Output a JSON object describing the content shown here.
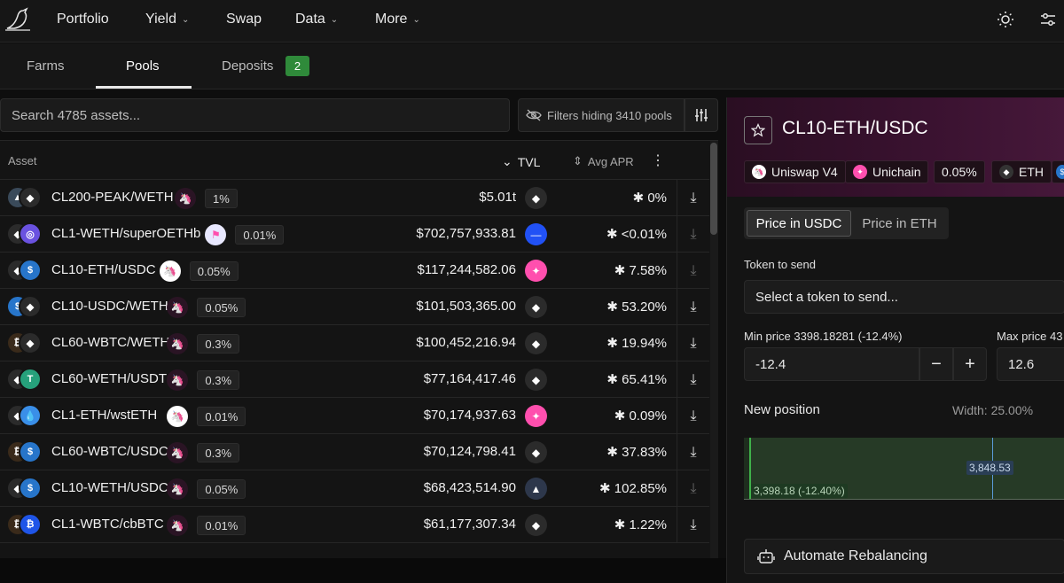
{
  "nav": {
    "items": [
      {
        "label": "Portfolio",
        "has_dropdown": false
      },
      {
        "label": "Yield",
        "has_dropdown": true
      },
      {
        "label": "Swap",
        "has_dropdown": false
      },
      {
        "label": "Data",
        "has_dropdown": true
      },
      {
        "label": "More",
        "has_dropdown": true
      }
    ],
    "icons": [
      "theme-toggle-icon",
      "settings-icon"
    ]
  },
  "subtabs": {
    "items": [
      {
        "label": "Farms"
      },
      {
        "label": "Pools"
      },
      {
        "label": "Deposits"
      }
    ],
    "active": "Pools",
    "deposits_count": "2"
  },
  "search": {
    "placeholder": "Search 4785 assets...",
    "filter_text": "Filters hiding 3410 pools"
  },
  "table": {
    "columns": {
      "asset": "Asset",
      "tvl": "TVL",
      "apr": "Avg APR"
    },
    "rows": [
      {
        "pair": "CL200-PEAK/WETH",
        "fee": "1%",
        "tvl": "$5.01t",
        "apr": "0%",
        "chain": "eth",
        "dex": "uni-dark",
        "download_dim": false
      },
      {
        "pair": "CL1-WETH/superOETHb",
        "fee": "0.01%",
        "tvl": "$702,757,933.81",
        "apr": "<0.01%",
        "chain": "base",
        "dex": "flag",
        "download_dim": true
      },
      {
        "pair": "CL10-ETH/USDC",
        "fee": "0.05%",
        "tvl": "$117,244,582.06",
        "apr": "7.58%",
        "chain": "unichain",
        "dex": "uni-light",
        "download_dim": true
      },
      {
        "pair": "CL10-USDC/WETH",
        "fee": "0.05%",
        "tvl": "$101,503,365.00",
        "apr": "53.20%",
        "chain": "eth",
        "dex": "uni-dark",
        "download_dim": false
      },
      {
        "pair": "CL60-WBTC/WETH",
        "fee": "0.3%",
        "tvl": "$100,452,216.94",
        "apr": "19.94%",
        "chain": "eth",
        "dex": "uni-dark",
        "download_dim": false
      },
      {
        "pair": "CL60-WETH/USDT",
        "fee": "0.3%",
        "tvl": "$77,164,417.46",
        "apr": "65.41%",
        "chain": "eth",
        "dex": "uni-dark",
        "download_dim": false
      },
      {
        "pair": "CL1-ETH/wstETH",
        "fee": "0.01%",
        "tvl": "$70,174,937.63",
        "apr": "0.09%",
        "chain": "unichain",
        "dex": "uni-light",
        "download_dim": false
      },
      {
        "pair": "CL60-WBTC/USDC",
        "fee": "0.3%",
        "tvl": "$70,124,798.41",
        "apr": "37.83%",
        "chain": "eth",
        "dex": "uni-dark",
        "download_dim": false
      },
      {
        "pair": "CL10-WETH/USDC",
        "fee": "0.05%",
        "tvl": "$68,423,514.90",
        "apr": "102.85%",
        "chain": "arbitrum",
        "dex": "uni-dark",
        "download_dim": true
      },
      {
        "pair": "CL1-WBTC/cbBTC",
        "fee": "0.01%",
        "tvl": "$61,177,307.34",
        "apr": "1.22%",
        "chain": "eth",
        "dex": "uni-dark",
        "download_dim": false
      }
    ]
  },
  "panel": {
    "title": "CL10-ETH/USDC",
    "chips": [
      {
        "label": "Uniswap V4"
      },
      {
        "label": "Unichain"
      },
      {
        "label": "0.05%"
      },
      {
        "label": "ETH"
      }
    ],
    "price_toggle": {
      "options": [
        "Price in USDC",
        "Price in ETH"
      ],
      "active": "Price in USDC"
    },
    "token_to_send_label": "Token to send",
    "token_select_placeholder": "Select a token to send...",
    "min_price_label": "Min price 3398.18281 (-12.4%)",
    "min_price_value": "-12.4",
    "max_price_label": "Max price 43",
    "max_price_value": "12.6",
    "new_position_label": "New position",
    "width_label": "Width: 25.00%",
    "range_min_tag": "3,398.18 (-12.40%)",
    "current_price_tag": "3,848.53",
    "automate_label": "Automate Rebalancing"
  },
  "colors": {
    "accent_green": "#2f8a3a",
    "uniswap_pink": "#ff4fae",
    "base_blue": "#2151f5"
  }
}
